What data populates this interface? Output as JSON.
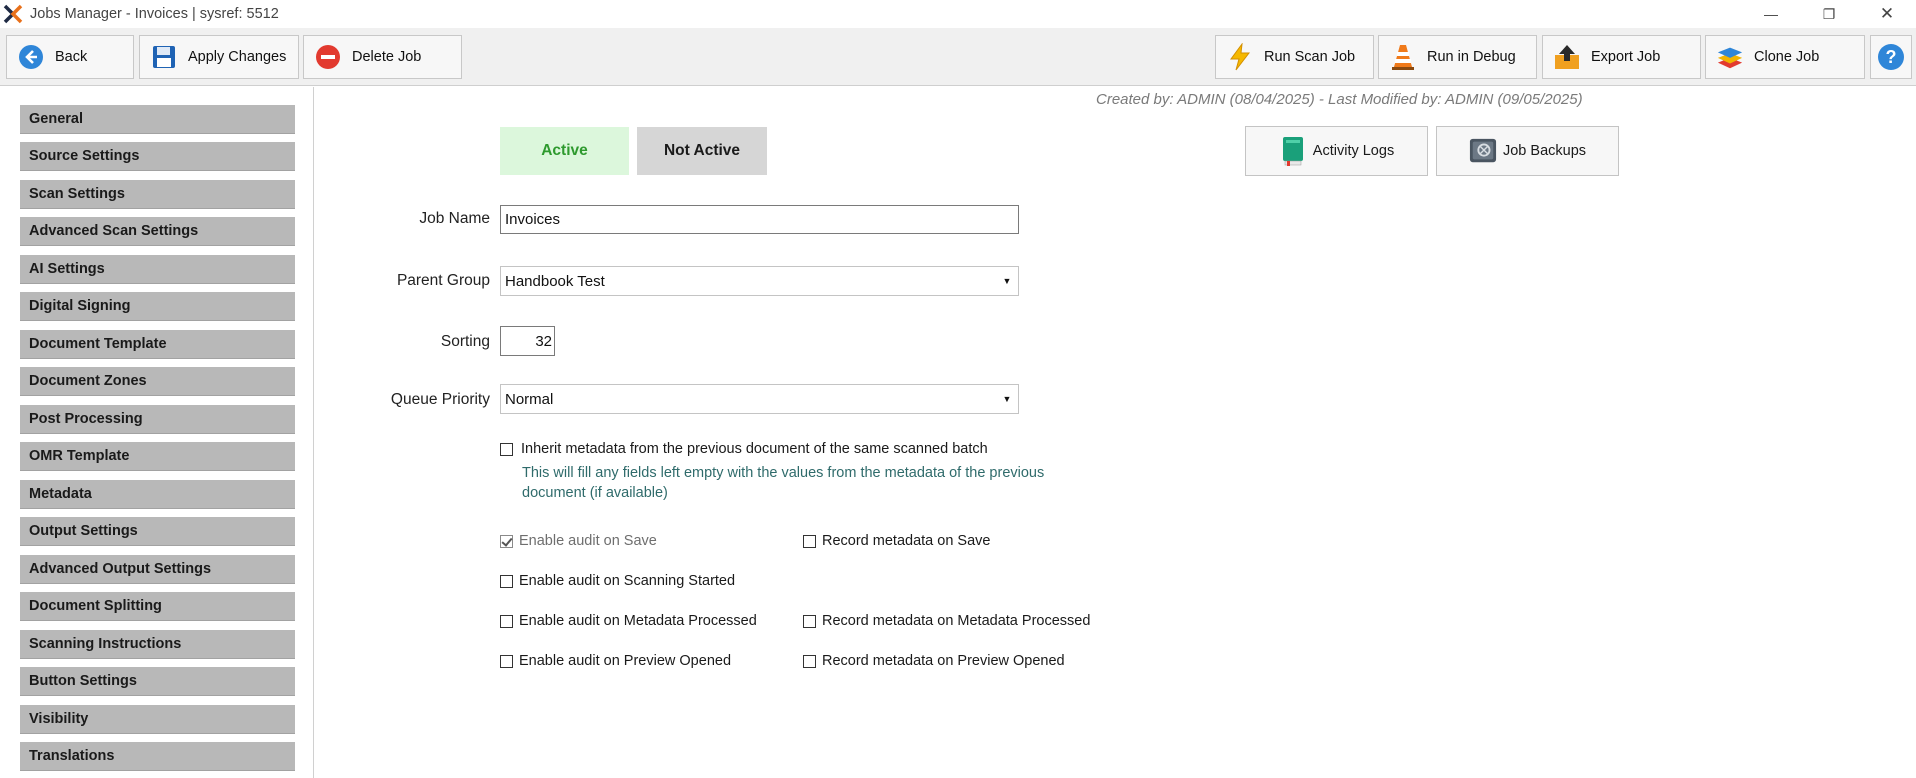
{
  "window": {
    "title": "Jobs Manager - Invoices  |  sysref: 5512",
    "minimize": "—",
    "maximize": "❐",
    "close": "✕"
  },
  "toolbar": {
    "back": "Back",
    "apply": "Apply Changes",
    "delete": "Delete Job",
    "run_scan": "Run Scan Job",
    "run_debug": "Run in Debug",
    "export": "Export Job",
    "clone": "Clone Job",
    "help": "?"
  },
  "sidebar": {
    "items": [
      "General",
      "Source Settings",
      "Scan Settings",
      "Advanced Scan Settings",
      "AI Settings",
      "Digital Signing",
      "Document Template",
      "Document Zones",
      "Post Processing",
      "OMR Template",
      "Metadata",
      "Output Settings",
      "Advanced Output Settings",
      "Document Splitting",
      "Scanning Instructions",
      "Button Settings",
      "Visibility",
      "Translations"
    ]
  },
  "main": {
    "meta_line": "Created by:  ADMIN  (08/04/2025)   -   Last Modified by:  ADMIN  (09/05/2025)",
    "status_active": "Active",
    "status_inactive": "Not Active",
    "activity_logs": "Activity Logs",
    "job_backups": "Job Backups",
    "job_name_label": "Job Name",
    "job_name_value": "Invoices",
    "parent_group_label": "Parent Group",
    "parent_group_value": "Handbook Test",
    "sorting_label": "Sorting",
    "sorting_value": "32",
    "queue_priority_label": "Queue Priority",
    "queue_priority_value": "Normal",
    "inherit_label": "Inherit metadata from the previous document of the same scanned batch",
    "inherit_checked": false,
    "inherit_hint": "This will fill any fields left empty with the values from the metadata of the previous document (if available)",
    "audit": {
      "save": "Enable audit on Save",
      "save_checked": true,
      "scanning": "Enable audit on Scanning Started",
      "scanning_checked": false,
      "metadata": "Enable audit on Metadata Processed",
      "metadata_checked": false,
      "preview": "Enable audit on Preview Opened",
      "preview_checked": false
    },
    "record": {
      "save": "Record metadata on Save",
      "save_checked": false,
      "metadata": "Record metadata on Metadata Processed",
      "metadata_checked": false,
      "preview": "Record metadata on Preview Opened",
      "preview_checked": false
    }
  },
  "colors": {
    "active_bg": "#dcf7dc",
    "active_text": "#2e9a2e",
    "nav_bg": "#b8b8b8",
    "hint_text": "#2f6b6b"
  }
}
